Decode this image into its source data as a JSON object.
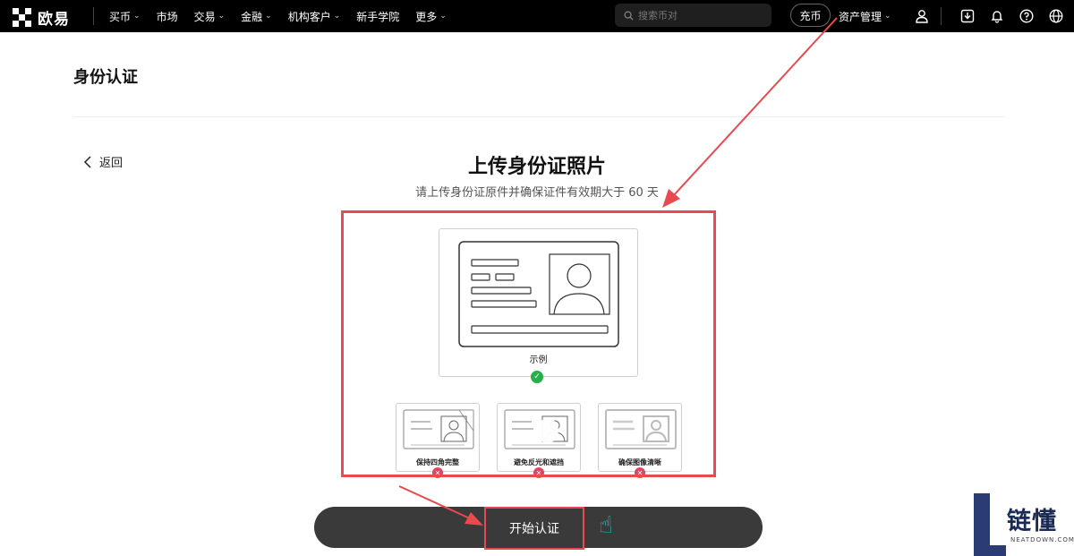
{
  "nav": {
    "logo_text": "欧易",
    "menu": [
      {
        "label": "买币",
        "dropdown": true
      },
      {
        "label": "市场",
        "dropdown": false
      },
      {
        "label": "交易",
        "dropdown": true
      },
      {
        "label": "金融",
        "dropdown": true
      },
      {
        "label": "机构客户",
        "dropdown": true
      },
      {
        "label": "新手学院",
        "dropdown": false
      },
      {
        "label": "更多",
        "dropdown": true
      }
    ],
    "search_placeholder": "搜索币对",
    "deposit_label": "充币",
    "asset_label": "资产管理",
    "icons": [
      "user-icon",
      "download-icon",
      "bell-icon",
      "help-icon",
      "globe-icon"
    ]
  },
  "page": {
    "title": "身份认证",
    "back_label": "返回",
    "heading": "上传身份证照片",
    "subheading": "请上传身份证原件并确保证件有效期大于 60 天"
  },
  "example": {
    "label": "示例",
    "status": "check-icon"
  },
  "bad_examples": [
    {
      "label": "保持四角完整"
    },
    {
      "label": "避免反光和遮挡"
    },
    {
      "label": "确保图像清晰"
    }
  ],
  "cta": {
    "label": "开始认证"
  },
  "watermark": {
    "text": "链懂",
    "sub": "NEATDOWN.COM"
  },
  "colors": {
    "accent_red": "#e84a4f",
    "success_green": "#25b04a",
    "error_pink": "#e04462",
    "cta_bg": "#3a3a3a",
    "nav_bg": "#000000"
  }
}
